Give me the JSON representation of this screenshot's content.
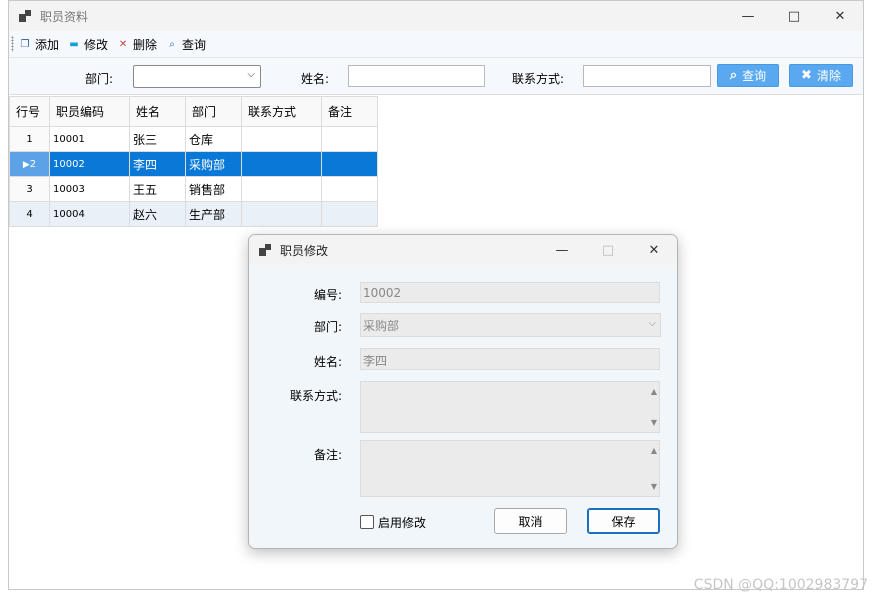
{
  "window": {
    "title": "职员资料"
  },
  "toolbar": {
    "add": "添加",
    "edit": "修改",
    "delete": "删除",
    "query": "查询"
  },
  "filter": {
    "dept_label": "部门:",
    "name_label": "姓名:",
    "contact_label": "联系方式:",
    "query_button": "查询",
    "clear_button": "清除"
  },
  "grid": {
    "headers": [
      "行号",
      "职员编码",
      "姓名",
      "部门",
      "联系方式",
      "备注"
    ],
    "rows": [
      {
        "no": "1",
        "code": "10001",
        "name": "张三",
        "dept": "仓库",
        "contact": "",
        "note": ""
      },
      {
        "no": "2",
        "code": "10002",
        "name": "李四",
        "dept": "采购部",
        "contact": "",
        "note": ""
      },
      {
        "no": "3",
        "code": "10003",
        "name": "王五",
        "dept": "销售部",
        "contact": "",
        "note": ""
      },
      {
        "no": "4",
        "code": "10004",
        "name": "赵六",
        "dept": "生产部",
        "contact": "",
        "note": ""
      }
    ],
    "selected_row": 2
  },
  "dialog": {
    "title": "职员修改",
    "code_label": "编号:",
    "code_value": "10002",
    "dept_label": "部门:",
    "dept_value": "采购部",
    "name_label": "姓名:",
    "name_value": "李四",
    "contact_label": "联系方式:",
    "contact_value": "",
    "note_label": "备注:",
    "note_value": "",
    "enable_edit_label": "启用修改",
    "cancel_button": "取消",
    "save_button": "保存"
  },
  "watermark": "CSDN @QQ:1002983797",
  "colors": {
    "accent": "#5aa9f0",
    "selection": "#0a78d7"
  }
}
